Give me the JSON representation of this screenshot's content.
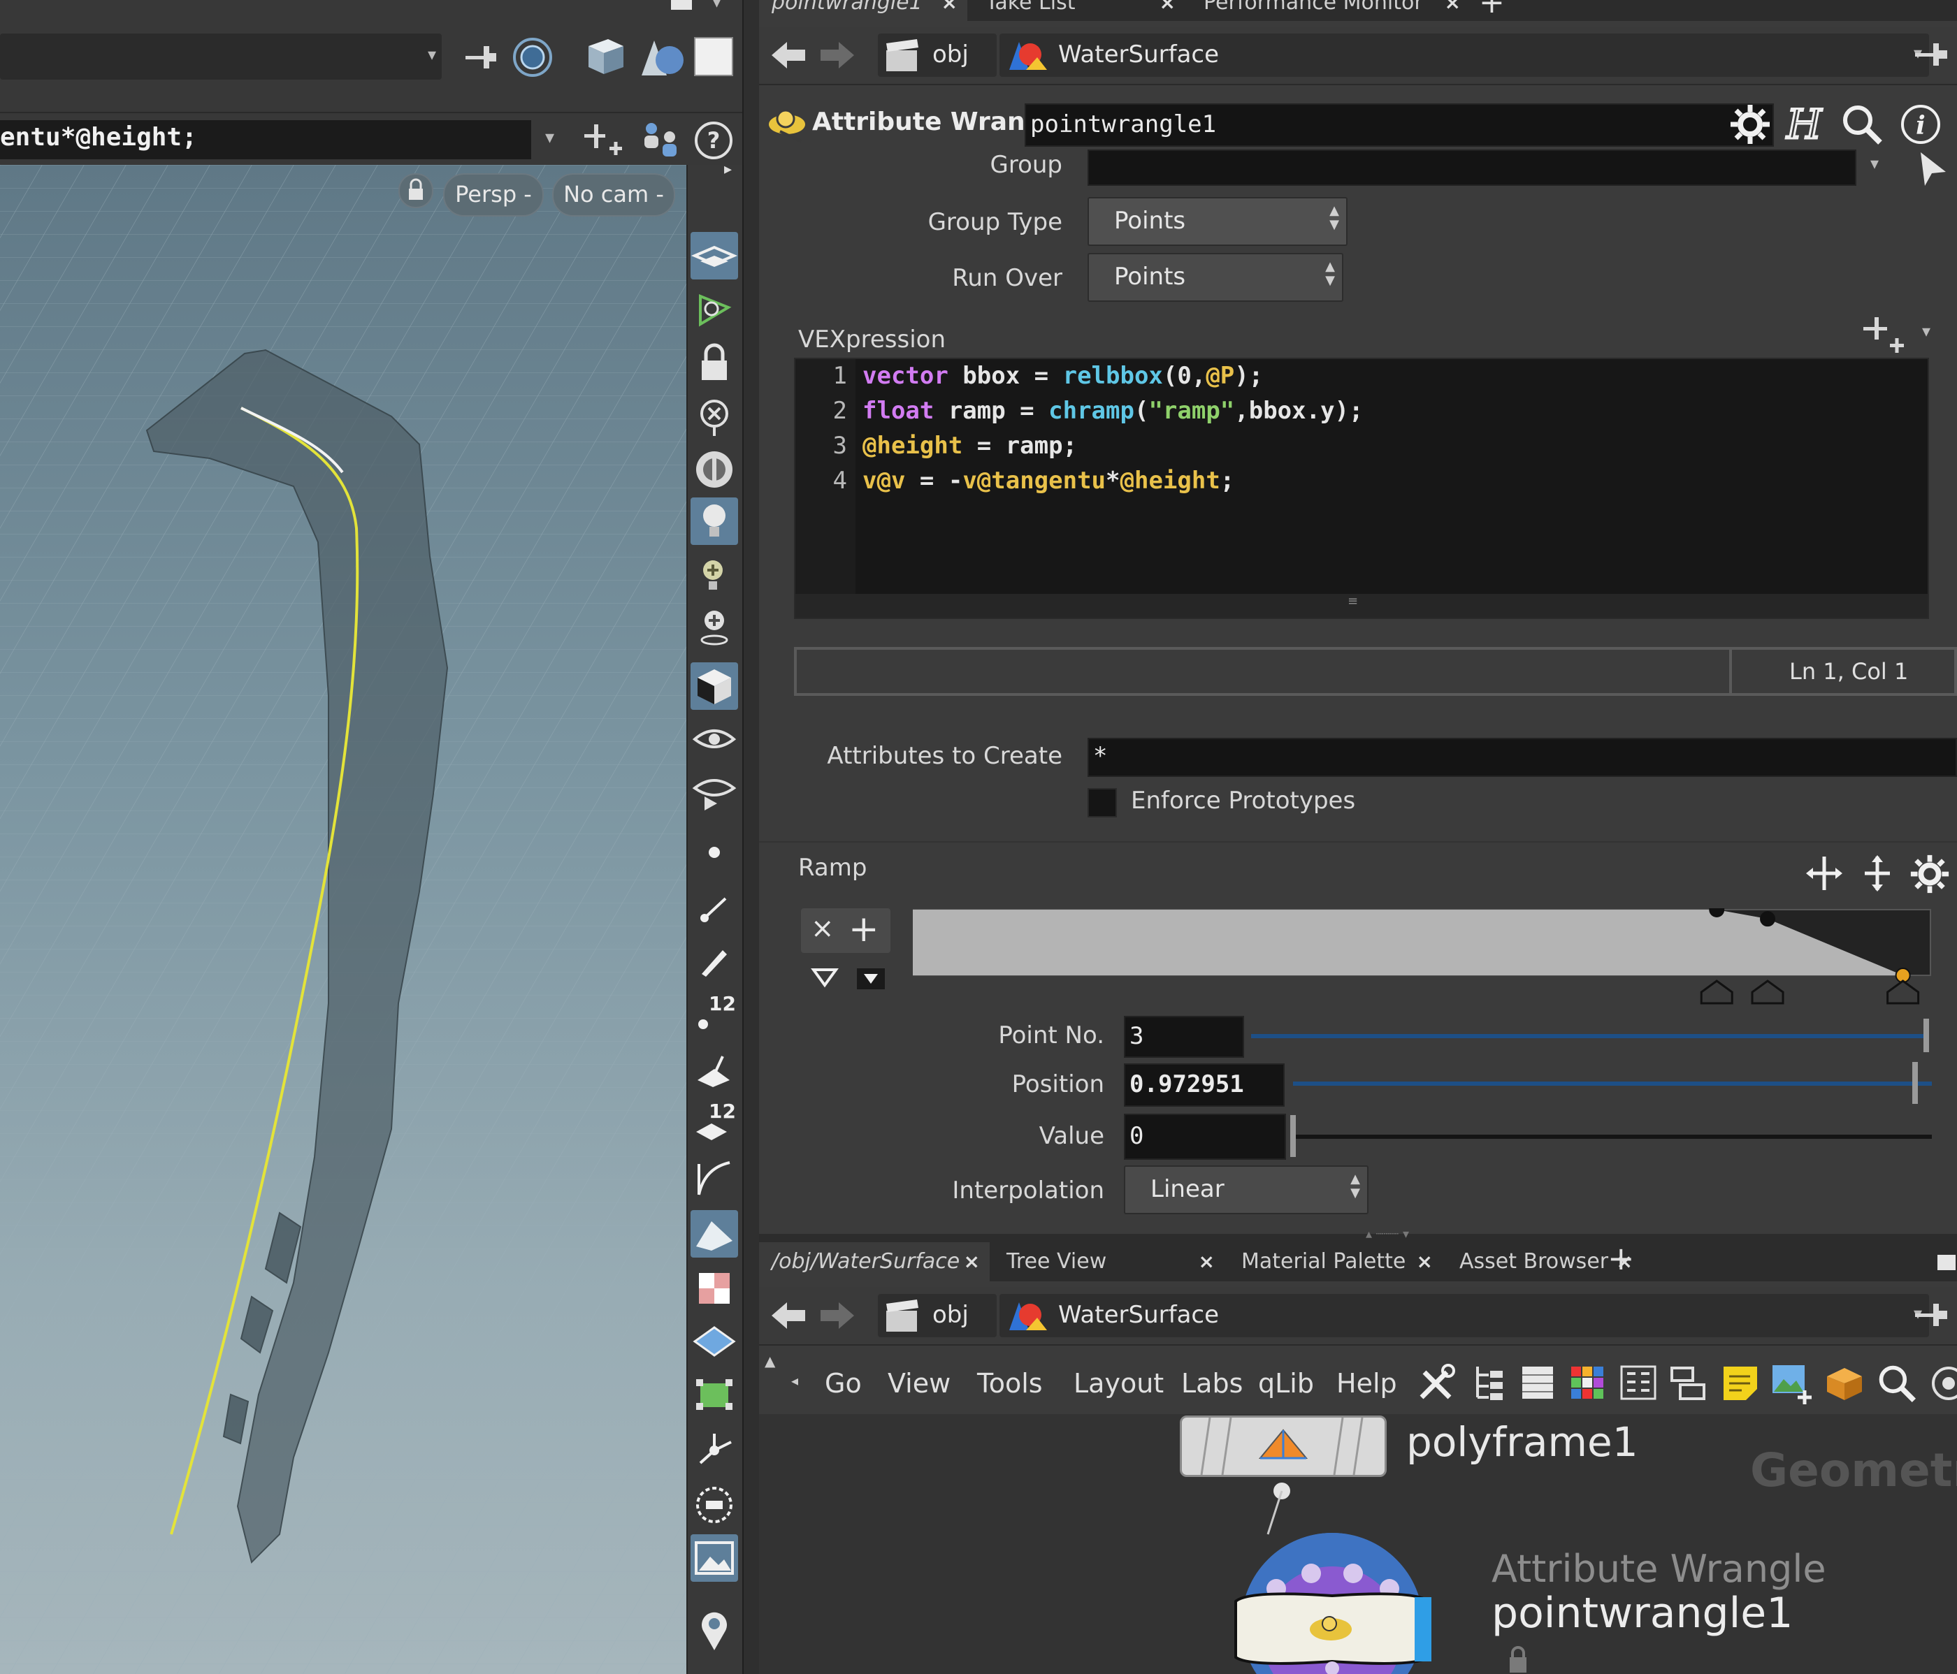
{
  "viewport": {
    "expression_text": "entu*@height;",
    "persp_label": "Persp -",
    "cam_label": "No cam -"
  },
  "top_tabs": [
    {
      "label": "pointwrangle1",
      "active": true
    },
    {
      "label": "Take List",
      "active": false
    },
    {
      "label": "Performance Monitor",
      "active": false
    }
  ],
  "top_path": {
    "root": "obj",
    "node": "WaterSurface"
  },
  "node_header": {
    "type_label": "Attribute Wrangle",
    "name": "pointwrangle1"
  },
  "params": {
    "group_label": "Group",
    "group_value": "",
    "group_type_label": "Group Type",
    "group_type_value": "Points",
    "run_over_label": "Run Over",
    "run_over_value": "Points",
    "vex_label": "VEXpression",
    "status_right": "Ln 1, Col 1",
    "attrs_create_label": "Attributes to Create",
    "attrs_create_value": "*",
    "enforce_label": "Enforce Prototypes",
    "enforce_checked": false,
    "ramp_label": "Ramp",
    "point_no_label": "Point No.",
    "point_no_value": "3",
    "position_label": "Position",
    "position_value": "0.972951",
    "value_label": "Value",
    "value_value": "0",
    "interp_label": "Interpolation",
    "interp_value": "Linear"
  },
  "code": {
    "line_numbers": [
      "1",
      "2",
      "3",
      "4"
    ],
    "lines": [
      [
        {
          "t": "vector",
          "c": "kw"
        },
        {
          "t": " bbox = ",
          "c": "pl"
        },
        {
          "t": "relbbox",
          "c": "fn"
        },
        {
          "t": "(0,",
          "c": "pl"
        },
        {
          "t": "@P",
          "c": "attr"
        },
        {
          "t": ");",
          "c": "pl"
        }
      ],
      [
        {
          "t": "float",
          "c": "kw"
        },
        {
          "t": " ramp = ",
          "c": "pl"
        },
        {
          "t": "chramp",
          "c": "fn"
        },
        {
          "t": "(",
          "c": "pl"
        },
        {
          "t": "\"ramp\"",
          "c": "str"
        },
        {
          "t": ",bbox.y);",
          "c": "pl"
        }
      ],
      [
        {
          "t": "@height",
          "c": "attr"
        },
        {
          "t": " = ramp;",
          "c": "pl"
        }
      ],
      [
        {
          "t": "v@v",
          "c": "attr"
        },
        {
          "t": " = -",
          "c": "pl"
        },
        {
          "t": "v@tangentu",
          "c": "attr"
        },
        {
          "t": "*",
          "c": "pl"
        },
        {
          "t": "@height",
          "c": "attr"
        },
        {
          "t": ";",
          "c": "pl"
        }
      ]
    ]
  },
  "ramp": {
    "keys": [
      {
        "position": 0.79,
        "value": 1
      },
      {
        "position": 0.84,
        "value": 0.86
      },
      {
        "position": 0.972951,
        "value": 0
      }
    ],
    "selected_key": 3
  },
  "bottom_tabs": [
    {
      "label": "/obj/WaterSurface",
      "active": true
    },
    {
      "label": "Tree View",
      "active": false
    },
    {
      "label": "Material Palette",
      "active": false
    },
    {
      "label": "Asset Browser",
      "active": false
    }
  ],
  "bottom_path": {
    "root": "obj",
    "node": "WaterSurface"
  },
  "network_menu": [
    "Go",
    "View",
    "Tools",
    "Layout",
    "Labs",
    "qLib",
    "Help"
  ],
  "network": {
    "node1_name": "polyframe1",
    "node2_type": "Attribute Wrangle",
    "node2_name": "pointwrangle1",
    "context_label": "Geometr"
  },
  "colors": {
    "accent_blue": "#5e7f9a",
    "curve_yellow": "#e3e33a",
    "ramp_key_orange": "#e7a11f",
    "code_keyword": "#d27cf2",
    "code_function": "#5fc7e6",
    "code_attribute": "#e9c14a",
    "code_string": "#8fd16b"
  }
}
